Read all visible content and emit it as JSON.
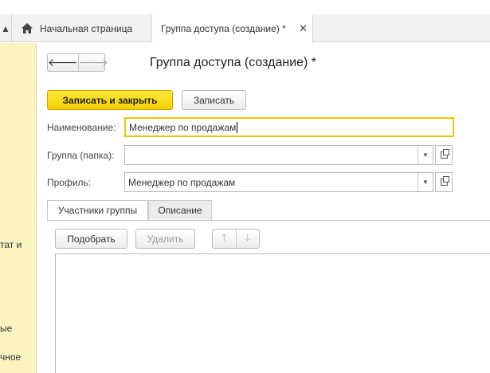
{
  "tabs": {
    "home_label": "Начальная страница",
    "active_label": "Группа доступа (создание) *"
  },
  "sidebar": {
    "fragments": [
      "тат и",
      "ые",
      "чное"
    ]
  },
  "form": {
    "title": "Группа доступа (создание) *",
    "save_close_label": "Записать и закрыть",
    "save_label": "Записать",
    "name_label": "Наименование:",
    "name_value": "Менеджер по продажам",
    "group_label": "Группа (папка):",
    "group_value": "",
    "profile_label": "Профиль:",
    "profile_value": "Менеджер по продажам"
  },
  "inner_tabs": {
    "members_label": "Участники группы",
    "description_label": "Описание"
  },
  "members_toolbar": {
    "pick_label": "Подобрать",
    "delete_label": "Удалить"
  },
  "colors": {
    "accent": "#f4d000",
    "sidebar_bg": "#fbf3c0"
  }
}
